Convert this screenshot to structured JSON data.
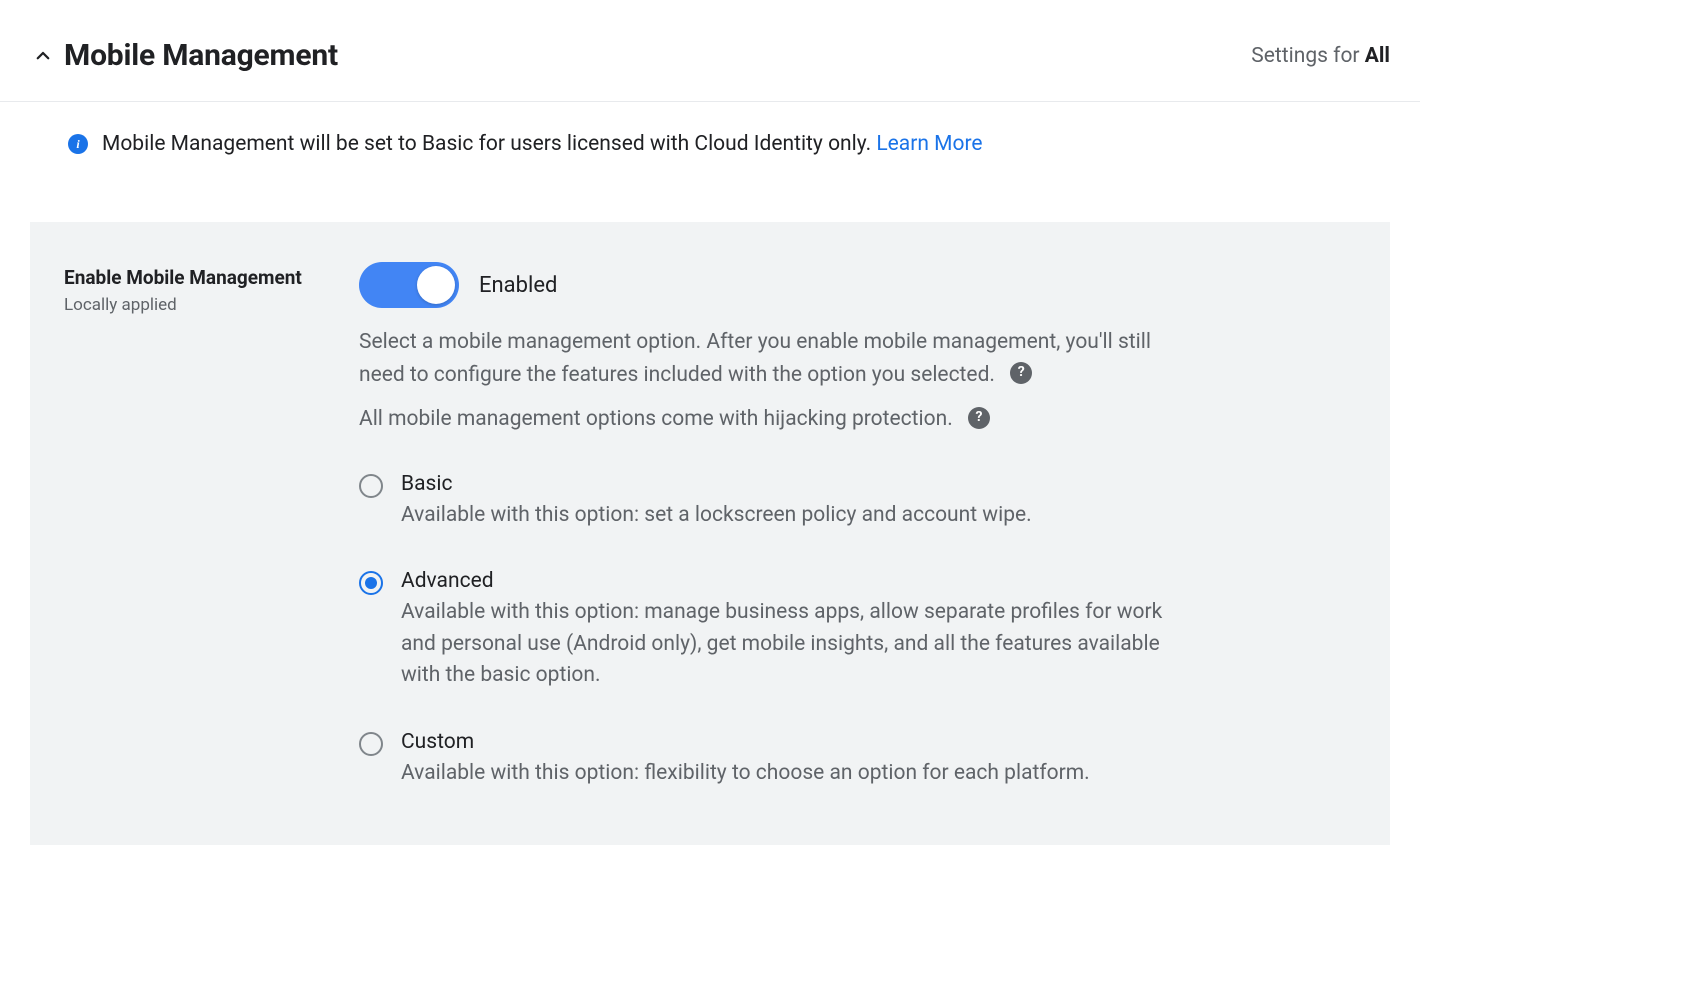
{
  "header": {
    "title": "Mobile Management",
    "settingsForPrefix": "Settings for ",
    "settingsForTarget": "All"
  },
  "infoBanner": {
    "text": "Mobile Management will be set to Basic for users licensed with Cloud Identity only. ",
    "learnMore": "Learn More"
  },
  "setting": {
    "title": "Enable Mobile Management",
    "subtitle": "Locally applied",
    "toggleLabel": "Enabled",
    "description1": "Select a mobile management option. After you enable mobile management, you'll still need to configure the features included with the option you selected.",
    "description2": "All mobile management options come with hijacking protection.",
    "options": [
      {
        "label": "Basic",
        "description": "Available with this option: set a lockscreen policy and account wipe.",
        "selected": false
      },
      {
        "label": "Advanced",
        "description": "Available with this option: manage business apps, allow separate profiles for work and personal use (Android only), get mobile insights, and all the features available with the basic option.",
        "selected": true
      },
      {
        "label": "Custom",
        "description": "Available with this option: flexibility to choose an option for each platform.",
        "selected": false
      }
    ]
  }
}
